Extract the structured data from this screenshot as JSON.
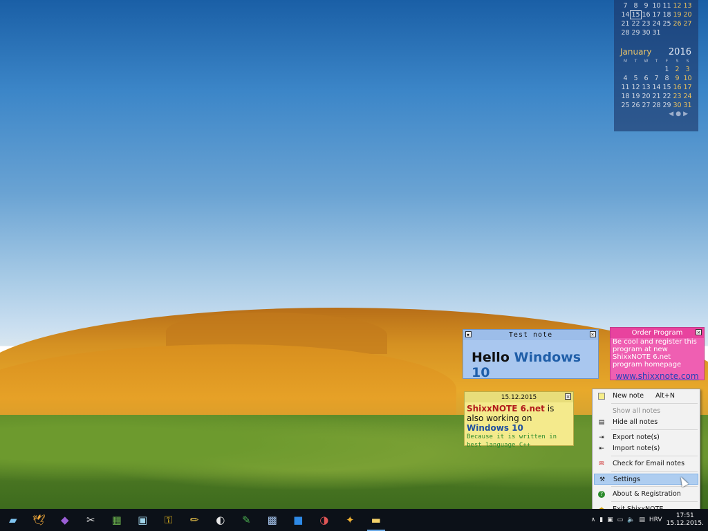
{
  "calendar": {
    "prev_weeks": [
      [
        "7",
        "8",
        "9",
        "10",
        "11",
        "12",
        "13"
      ],
      [
        "14",
        "15",
        "16",
        "17",
        "18",
        "19",
        "20"
      ],
      [
        "21",
        "22",
        "23",
        "24",
        "25",
        "26",
        "27"
      ],
      [
        "28",
        "29",
        "30",
        "31",
        "",
        "",
        ""
      ]
    ],
    "today": "15",
    "month": "January",
    "year": "2016",
    "dow": [
      "M",
      "T",
      "W",
      "T",
      "F",
      "S",
      "S"
    ],
    "weeks": [
      [
        "",
        "",
        "",
        "",
        "1",
        "2",
        "3"
      ],
      [
        "4",
        "5",
        "6",
        "7",
        "8",
        "9",
        "10"
      ],
      [
        "11",
        "12",
        "13",
        "14",
        "15",
        "16",
        "17"
      ],
      [
        "18",
        "19",
        "20",
        "21",
        "22",
        "23",
        "24"
      ],
      [
        "25",
        "26",
        "27",
        "28",
        "29",
        "30",
        "31"
      ]
    ]
  },
  "notes": {
    "test": {
      "title": "Test note",
      "text_plain": "Hello ",
      "text_blue": "Windows 10"
    },
    "order": {
      "title": "Order Program",
      "text": "Be cool and register this program at new ShixxNOTE 6.net program homepage",
      "link": "www.shixxnote.com"
    },
    "date": {
      "title": "15.12.2015",
      "red": "ShixxNOTE 6.net",
      "mid1": " is also working on ",
      "blue": "Windows 10",
      "mono": "Because it is written in best language C++"
    }
  },
  "menu": {
    "new_note": "New note",
    "new_note_shortcut": "Alt+N",
    "show_all": "Show all notes",
    "hide_all": "Hide all notes",
    "export": "Export note(s)",
    "import": "Import note(s)",
    "email": "Check for Email notes",
    "settings": "Settings",
    "about": "About & Registration",
    "exit": "Exit ShixxNOTE ..."
  },
  "taskbar": {
    "apps": [
      "windows-icon",
      "thunderbird-icon",
      "visual-studio-icon",
      "tools-icon",
      "spreadsheet-icon",
      "utility-icon",
      "key-icon",
      "pencil-icon",
      "paint-icon",
      "brush-icon",
      "monitor-icon",
      "blue-app-icon",
      "media-icon",
      "broom-icon",
      "folder-icon"
    ],
    "language": "HRV",
    "time": "17:51",
    "date": "15.12.2015."
  }
}
